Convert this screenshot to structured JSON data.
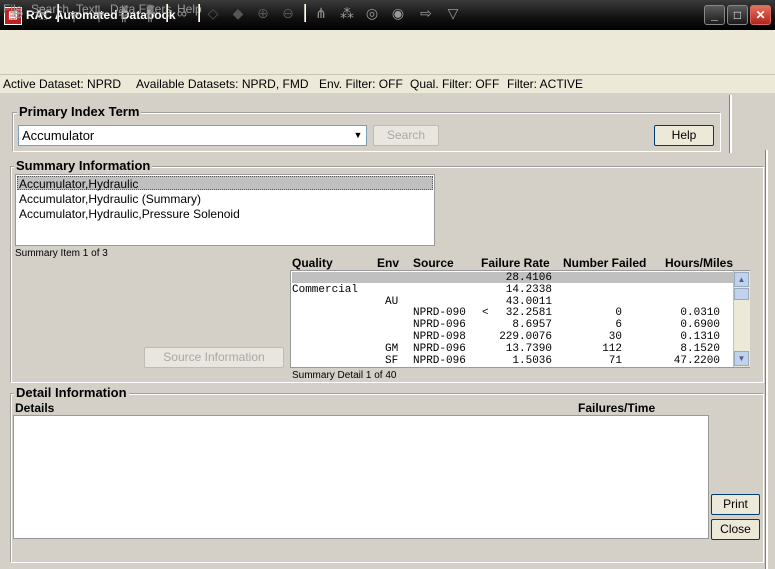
{
  "window": {
    "title": "RAC Automated Databook",
    "app_icon": "book-icon"
  },
  "menu": [
    "File",
    "Search",
    "Text",
    "Data Filters",
    "Help"
  ],
  "toolbar": {
    "icons": [
      "add-record-icon",
      "copy-record-icon",
      "tree-collapse-icon",
      "tree-expand-icon",
      "tree-branch-icon",
      "tree-leaf-icon",
      "find-binoculars-icon",
      "tag-icon",
      "tag-alt-icon",
      "zoom-in-icon",
      "zoom-out-icon",
      "hierarchy-icon",
      "network-icon",
      "sphere-icon",
      "sphere-alt-icon",
      "filter-arrow-icon",
      "funnel-icon"
    ]
  },
  "status": {
    "active_dataset": "Active Dataset: NPRD",
    "available": "Available Datasets: NPRD, FMD",
    "env_filter": "Env. Filter: OFF",
    "qual_filter": "Qual. Filter: OFF",
    "filter": "Filter: ACTIVE"
  },
  "primary": {
    "legend": "Primary Index Term",
    "value": "Accumulator",
    "search_label": "Search",
    "help_label": "Help"
  },
  "summary": {
    "legend": "Summary Information",
    "items": [
      "Accumulator,Hydraulic",
      "Accumulator,Hydraulic (Summary)",
      "Accumulator,Hydraulic,Pressure Solenoid"
    ],
    "count": "Summary Item 1 of 3",
    "source_button": "Source Information",
    "headers": {
      "quality": "Quality",
      "env": "Env",
      "source": "Source",
      "rate": "Failure Rate",
      "failed": "Number Failed",
      "hours": "Hours/Miles"
    },
    "rows": [
      {
        "q": "",
        "env": "",
        "src": "",
        "flag": "",
        "rate": "28.4106",
        "failed": "",
        "hours": ""
      },
      {
        "q": "Commercial",
        "env": "",
        "src": "",
        "flag": "",
        "rate": "14.2338",
        "failed": "",
        "hours": ""
      },
      {
        "q": "",
        "env": "AU",
        "src": "",
        "flag": "",
        "rate": "43.0011",
        "failed": "",
        "hours": ""
      },
      {
        "q": "",
        "env": "",
        "src": "NPRD-090",
        "flag": "<",
        "rate": "32.2581",
        "failed": "0",
        "hours": "0.0310"
      },
      {
        "q": "",
        "env": "",
        "src": "NPRD-096",
        "flag": "",
        "rate": "8.6957",
        "failed": "6",
        "hours": "0.6900"
      },
      {
        "q": "",
        "env": "",
        "src": "NPRD-098",
        "flag": "",
        "rate": "229.0076",
        "failed": "30",
        "hours": "0.1310"
      },
      {
        "q": "",
        "env": "GM",
        "src": "NPRD-096",
        "flag": "",
        "rate": "13.7390",
        "failed": "112",
        "hours": "8.1520"
      },
      {
        "q": "",
        "env": "SF",
        "src": "NPRD-096",
        "flag": "",
        "rate": "1.5036",
        "failed": "71",
        "hours": "47.2200"
      }
    ],
    "detail_count": "Summary Detail 1 of 40"
  },
  "detail": {
    "legend": "Detail Information",
    "col_details": "Details",
    "col_failures": "Failures/Time",
    "print_label": "Print",
    "close_label": "Close"
  }
}
